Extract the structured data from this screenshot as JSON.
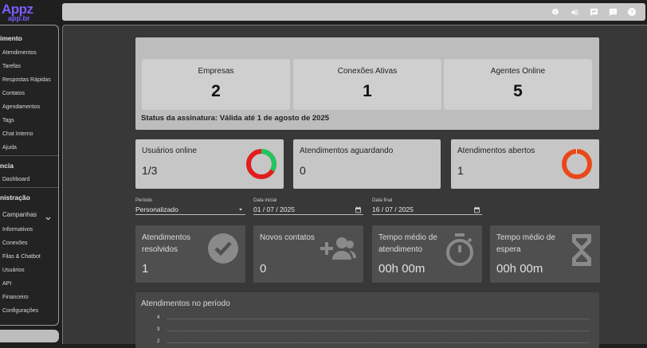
{
  "logo": {
    "main": "Appz",
    "sub": "app.br"
  },
  "topbar": {
    "icons": [
      "bug-icon",
      "volume-icon",
      "chat-icon",
      "alert-icon",
      "help-icon"
    ]
  },
  "sidebar": {
    "section_attendance": "imento",
    "attendance_items": [
      "Atendimentos",
      "Tarefas",
      "Respostas Rápidas",
      "Contatos",
      "Agendamentos",
      "Tags",
      "Chat Interno",
      "Ajuda"
    ],
    "section_management": "ncia",
    "management_items": [
      "Dashboard"
    ],
    "section_admin": "nistração",
    "campaigns_label": "Campanhas",
    "admin_items": [
      "Informativos",
      "Conexões",
      "Filas & Chatbot",
      "Usuários",
      "API",
      "Financeiro",
      "Configurações"
    ]
  },
  "summary": {
    "stats": [
      {
        "label": "Empresas",
        "value": "2"
      },
      {
        "label": "Conexões Ativas",
        "value": "1"
      },
      {
        "label": "Agentes Online",
        "value": "5"
      }
    ],
    "subscription_status": "Status da assinatura: Válida até 1 de agosto de 2025"
  },
  "cards": [
    {
      "label": "Usuários online",
      "value": "1/3",
      "donut": {
        "fraction": 0.333,
        "on": "#22c55e",
        "off": "#e11d1d"
      }
    },
    {
      "label": "Atendimentos aguardando",
      "value": "0"
    },
    {
      "label": "Atendimentos abertos",
      "value": "1",
      "donut": {
        "fraction": 0.99,
        "on": "#e8481a",
        "off": "#ffffff"
      }
    }
  ],
  "filters": {
    "period": {
      "label": "Período",
      "value": "Personalizado"
    },
    "start": {
      "label": "Data inicial",
      "value": "01 / 07 / 2025"
    },
    "end": {
      "label": "Data final",
      "value": "16 / 07 / 2025"
    }
  },
  "metrics": [
    {
      "label": "Atendimentos resolvidos",
      "value": "1",
      "icon": "check-circle-icon"
    },
    {
      "label": "Novos contatos",
      "value": "0",
      "icon": "add-users-icon"
    },
    {
      "label": "Tempo médio de atendimento",
      "value": "00h 00m",
      "icon": "stopwatch-icon"
    },
    {
      "label": "Tempo médio de espera",
      "value": "00h 00m",
      "icon": "hourglass-icon"
    }
  ],
  "chart_data": {
    "type": "line",
    "title": "Atendimentos no período",
    "y_ticks": [
      "4",
      "3",
      "2"
    ],
    "grid": true
  }
}
